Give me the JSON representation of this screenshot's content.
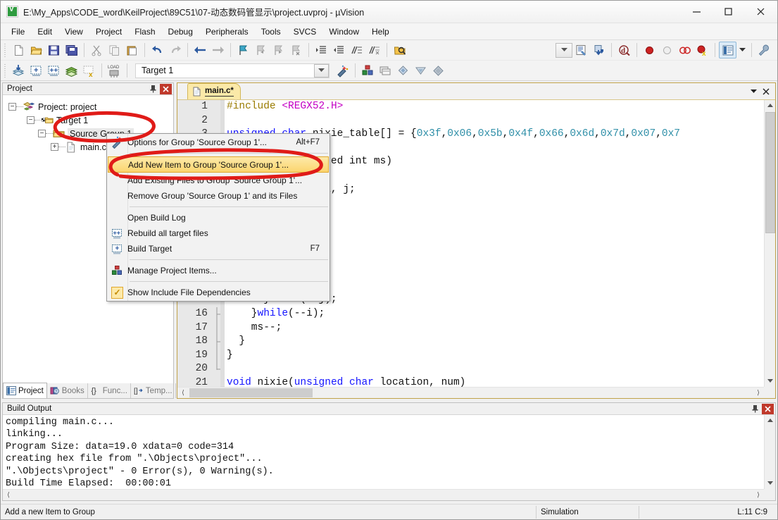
{
  "window": {
    "title": "E:\\My_Apps\\CODE_word\\KeilProject\\89C51\\07-动态数码管显示\\project.uvproj - µVision",
    "icon": "uvision-icon",
    "minimize": "—",
    "maximize": "☐",
    "close": "✕"
  },
  "menubar": {
    "items": [
      "File",
      "Edit",
      "View",
      "Project",
      "Flash",
      "Debug",
      "Peripherals",
      "Tools",
      "SVCS",
      "Window",
      "Help"
    ]
  },
  "toolbar": {
    "target_value": "Target 1",
    "dropdown_arrow": "▼"
  },
  "project_panel": {
    "title": "Project",
    "pin": "⚐",
    "close": "✕",
    "tree": [
      {
        "label": "Project: project",
        "level": 0,
        "expander": "-",
        "icon": "project-icon"
      },
      {
        "label": "Target 1",
        "level": 1,
        "expander": "-",
        "icon": "target-folder-icon"
      },
      {
        "label": "Source Group 1",
        "level": 2,
        "expander": "-",
        "icon": "folder-icon",
        "selected": true
      },
      {
        "label": "main.c",
        "level": 3,
        "expander": "+",
        "icon": "c-file-icon"
      }
    ],
    "tabs": [
      {
        "label": "Project",
        "icon": "project-tab-icon",
        "active": true
      },
      {
        "label": "Books",
        "icon": "books-icon",
        "active": false
      },
      {
        "label": "Func...",
        "icon": "braces-icon",
        "active": false
      },
      {
        "label": "Temp...",
        "icon": "template-icon",
        "active": false
      }
    ]
  },
  "context_menu": {
    "items": [
      {
        "label": "Options for Group 'Source Group 1'...",
        "shortcut": "Alt+F7",
        "icon": "options-wand-icon",
        "highlighted": false,
        "separator_after": true
      },
      {
        "label": "Add New  Item to Group 'Source Group 1'...",
        "shortcut": "",
        "icon": "",
        "highlighted": true
      },
      {
        "label": "Add Existing Files to Group 'Source Group 1'...",
        "shortcut": "",
        "icon": "",
        "highlighted": false
      },
      {
        "label": "Remove Group 'Source Group 1' and its Files",
        "shortcut": "",
        "icon": "",
        "highlighted": false,
        "separator_after": true
      },
      {
        "label": "Open Build Log",
        "shortcut": "",
        "icon": "",
        "highlighted": false
      },
      {
        "label": "Rebuild all target files",
        "shortcut": "",
        "icon": "rebuild-icon",
        "highlighted": false
      },
      {
        "label": "Build Target",
        "shortcut": "F7",
        "icon": "build-icon",
        "highlighted": false,
        "separator_after": true
      },
      {
        "label": "Manage Project Items...",
        "shortcut": "",
        "icon": "manage-items-icon",
        "highlighted": false,
        "separator_after": true
      },
      {
        "label": "Show Include File Dependencies",
        "shortcut": "",
        "icon": "checkmark-icon",
        "highlighted": false
      }
    ]
  },
  "editor": {
    "tab": {
      "label": "main.c*",
      "icon": "c-file-icon"
    },
    "dropdown": "▼",
    "close": "✕",
    "lines": [
      {
        "no": "1",
        "tokens": [
          {
            "t": "#include ",
            "c": "pp"
          },
          {
            "t": "<REGX52.H>",
            "c": "hdr"
          }
        ]
      },
      {
        "no": "2",
        "tokens": []
      },
      {
        "no": "3",
        "tokens": [
          {
            "t": "unsigned char ",
            "c": "kw"
          },
          {
            "t": "nixie_table[] = {",
            "c": "plain"
          },
          {
            "t": "0x3f",
            "c": "num"
          },
          {
            "t": ",",
            "c": "plain"
          },
          {
            "t": "0x06",
            "c": "num"
          },
          {
            "t": ",",
            "c": "plain"
          },
          {
            "t": "0x5b",
            "c": "num"
          },
          {
            "t": ",",
            "c": "plain"
          },
          {
            "t": "0x4f",
            "c": "num"
          },
          {
            "t": ",",
            "c": "plain"
          },
          {
            "t": "0x66",
            "c": "num"
          },
          {
            "t": ",",
            "c": "plain"
          },
          {
            "t": "0x6d",
            "c": "num"
          },
          {
            "t": ",",
            "c": "plain"
          },
          {
            "t": "0x7d",
            "c": "num"
          },
          {
            "t": ",",
            "c": "plain"
          },
          {
            "t": "0x07",
            "c": "num"
          },
          {
            "t": ",",
            "c": "plain"
          },
          {
            "t": "0x7",
            "c": "num"
          }
        ]
      },
      {
        "no": "4",
        "tokens": []
      },
      {
        "no": "5",
        "tokens": [
          {
            "t": "void delay(unsigned int ms)",
            "c": "plain"
          }
        ]
      },
      {
        "no": "6",
        "tokens": []
      },
      {
        "no": "7",
        "tokens": [
          {
            "t": "  unsigned char i, j;",
            "c": "plain"
          }
        ]
      },
      {
        "no": "8",
        "tokens": []
      },
      {
        "no": "9",
        "tokens": []
      },
      {
        "no": "10",
        "tokens": []
      },
      {
        "no": "11",
        "tokens": []
      },
      {
        "no": "12",
        "tokens": []
      },
      {
        "no": "13",
        "tokens": []
      },
      {
        "no": "14",
        "tokens": []
      },
      {
        "no": "15",
        "tokens": [
          {
            "t": "      }while(--j);",
            "c": "plain"
          }
        ]
      },
      {
        "no": "16",
        "tokens": [
          {
            "t": "    }",
            "c": "plain"
          },
          {
            "t": "while",
            "c": "kw"
          },
          {
            "t": "(--i);",
            "c": "plain"
          }
        ]
      },
      {
        "no": "17",
        "tokens": [
          {
            "t": "    ms--;",
            "c": "plain"
          }
        ]
      },
      {
        "no": "18",
        "tokens": [
          {
            "t": "  }",
            "c": "plain"
          }
        ]
      },
      {
        "no": "19",
        "tokens": [
          {
            "t": "}",
            "c": "plain"
          }
        ]
      },
      {
        "no": "20",
        "tokens": []
      },
      {
        "no": "21",
        "tokens": [
          {
            "t": "void ",
            "c": "kw"
          },
          {
            "t": "nixie(",
            "c": "plain"
          },
          {
            "t": "unsigned char ",
            "c": "kw"
          },
          {
            "t": "location, num)",
            "c": "plain"
          }
        ]
      }
    ]
  },
  "build_output": {
    "title": "Build Output",
    "pin": "⚐",
    "close": "✕",
    "lines": [
      "compiling main.c...",
      "linking...",
      "Program Size: data=19.0 xdata=0 code=314",
      "creating hex file from \".\\Objects\\project\"...",
      "\".\\Objects\\project\" - 0 Error(s), 0 Warning(s).",
      "Build Time Elapsed:  00:00:01"
    ]
  },
  "statusbar": {
    "message": "Add a new Item to Group",
    "mode": "Simulation",
    "position": "L:11 C:9"
  },
  "colors": {
    "annotation_red": "#e01b18",
    "highlight_gold": "#fbd56e",
    "keyword_blue": "#1414ff",
    "number_teal": "#2f8fa8",
    "preproc_gold": "#9a7b00",
    "header_magenta": "#c300c3"
  }
}
